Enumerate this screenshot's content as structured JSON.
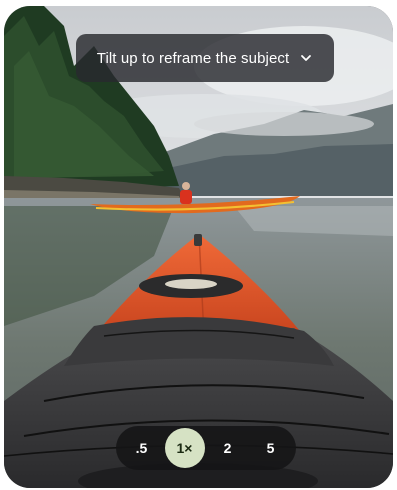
{
  "hint": {
    "text": "Tilt up to reframe the subject",
    "icon": "chevron-down-icon"
  },
  "zoom": {
    "options": [
      {
        "label": ".5",
        "active": false
      },
      {
        "label": "1×",
        "active": true
      },
      {
        "label": "2",
        "active": false
      },
      {
        "label": "5",
        "active": false
      }
    ]
  },
  "colors": {
    "chip_bg": "#2a2c2e",
    "zoom_bar_bg": "#141416",
    "zoom_active_bg": "#d6e2c4",
    "kayak_orange": "#e4562a"
  }
}
